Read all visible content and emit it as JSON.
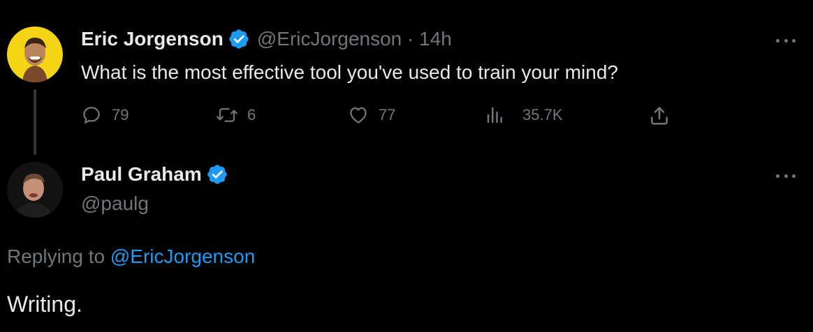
{
  "colors": {
    "background": "#000000",
    "text_primary": "#e7e9ea",
    "text_muted": "#71767b",
    "link": "#1d9bf0",
    "verified": "#1d9bf0",
    "eric_avatar_bg": "#f3d515"
  },
  "original_tweet": {
    "author_name": "Eric Jorgenson",
    "handle": "@EricJorgenson",
    "separator": "·",
    "time": "14h",
    "text": "What is the most effective tool you've used to train your mind?",
    "avatar_icon": "person-avatar-yellow",
    "actions": {
      "replies": {
        "icon": "reply-icon",
        "count": "79"
      },
      "retweets": {
        "icon": "retweet-icon",
        "count": "6"
      },
      "likes": {
        "icon": "heart-icon",
        "count": "77"
      },
      "views": {
        "icon": "views-icon",
        "count": "35.7K"
      },
      "share": {
        "icon": "share-icon"
      }
    }
  },
  "reply_tweet": {
    "author_name": "Paul Graham",
    "handle": "@paulg",
    "avatar_icon": "person-avatar-dark",
    "replying_prefix": "Replying to",
    "replying_to": "@EricJorgenson",
    "text": "Writing."
  }
}
